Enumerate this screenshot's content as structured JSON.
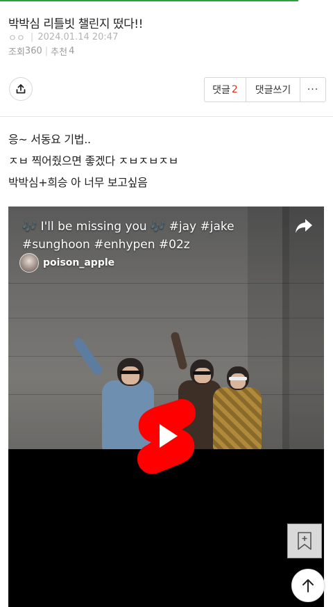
{
  "post": {
    "title": "박박심 리틀빗 챌린지 떴다!!",
    "author": "ㅇㅇ",
    "datetime": "2024.01.14 20:47",
    "views_label": "조회",
    "views": "360",
    "likes_label": "추천",
    "likes": "4"
  },
  "actions": {
    "comments_label": "댓글",
    "comments_count": "2",
    "write_label": "댓글쓰기",
    "more_label": "···"
  },
  "body": {
    "lines": [
      "응~ 서동요 기법..",
      "ㅈㅂ 찍어줬으면 좋겠다 ㅈㅂㅈㅂㅈㅂ",
      "박박심+희승 아 너무 보고싶음"
    ]
  },
  "video": {
    "title": "🎶 I'll be missing you 🎶 #jay #jake #sunghoon #enhypen #02z",
    "channel": "poison_apple",
    "brand_color": "#ff0000"
  },
  "icons": {
    "share": "share-icon",
    "bookmark": "bookmark-add-icon",
    "scroll_top": "arrow-up-icon",
    "play": "youtube-shorts-play-icon"
  }
}
